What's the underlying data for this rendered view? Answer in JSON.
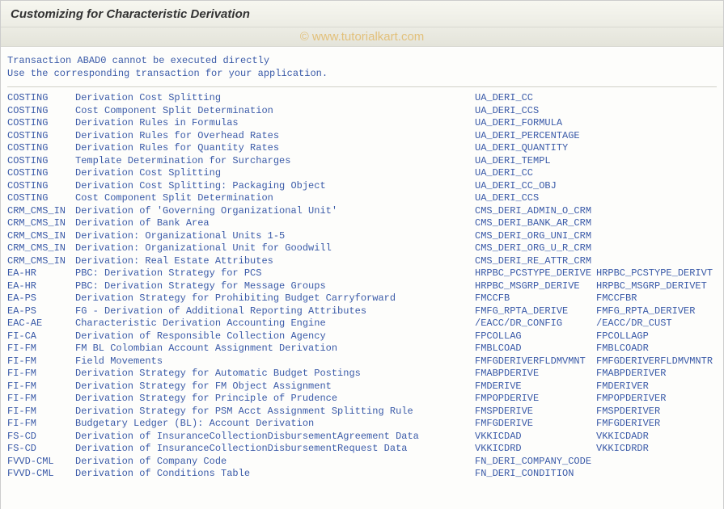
{
  "header": {
    "title": "Customizing for Characteristic Derivation",
    "watermark": "© www.tutorialkart.com"
  },
  "message": {
    "line1": "Transaction ABAD0 cannot be executed directly",
    "line2": "Use the corresponding transaction for your application."
  },
  "rows": [
    {
      "cat": "COSTING",
      "desc": "Derivation Cost Splitting",
      "cmd": "UA_DERI_CC",
      "cmd2": ""
    },
    {
      "cat": "COSTING",
      "desc": "Cost Component Split Determination",
      "cmd": "UA_DERI_CCS",
      "cmd2": ""
    },
    {
      "cat": "COSTING",
      "desc": "Derivation Rules in Formulas",
      "cmd": "UA_DERI_FORMULA",
      "cmd2": ""
    },
    {
      "cat": "COSTING",
      "desc": "Derivation Rules for Overhead Rates",
      "cmd": "UA_DERI_PERCENTAGE",
      "cmd2": ""
    },
    {
      "cat": "COSTING",
      "desc": "Derivation Rules for Quantity Rates",
      "cmd": "UA_DERI_QUANTITY",
      "cmd2": ""
    },
    {
      "cat": "COSTING",
      "desc": "Template Determination for Surcharges",
      "cmd": "UA_DERI_TEMPL",
      "cmd2": ""
    },
    {
      "cat": "COSTING",
      "desc": "Derivation Cost Splitting",
      "cmd": "UA_DERI_CC",
      "cmd2": ""
    },
    {
      "cat": "COSTING",
      "desc": "Derivation Cost Splitting: Packaging Object",
      "cmd": "UA_DERI_CC_OBJ",
      "cmd2": ""
    },
    {
      "cat": "COSTING",
      "desc": "Cost Component Split Determination",
      "cmd": "UA_DERI_CCS",
      "cmd2": ""
    },
    {
      "cat": "CRM_CMS_IN",
      "desc": "Derivation of 'Governing Organizational Unit'",
      "cmd": "CMS_DERI_ADMIN_O_CRM",
      "cmd2": ""
    },
    {
      "cat": "CRM_CMS_IN",
      "desc": "Derivation of Bank Area",
      "cmd": "CMS_DERI_BANK_AR_CRM",
      "cmd2": ""
    },
    {
      "cat": "CRM_CMS_IN",
      "desc": "Derivation: Organizational Units 1-5",
      "cmd": "CMS_DERI_ORG_UNI_CRM",
      "cmd2": ""
    },
    {
      "cat": "CRM_CMS_IN",
      "desc": "Derivation: Organizational Unit for Goodwill",
      "cmd": "CMS_DERI_ORG_U_R_CRM",
      "cmd2": ""
    },
    {
      "cat": "CRM_CMS_IN",
      "desc": "Derivation: Real Estate Attributes",
      "cmd": "CMS_DERI_RE_ATTR_CRM",
      "cmd2": ""
    },
    {
      "cat": "EA-HR",
      "desc": "PBC: Derivation Strategy for PCS",
      "cmd": "HRPBC_PCSTYPE_DERIVE",
      "cmd2": "HRPBC_PCSTYPE_DERIVT"
    },
    {
      "cat": "EA-HR",
      "desc": "PBC: Derivation Strategy for Message Groups",
      "cmd": "HRPBC_MSGRP_DERIVE",
      "cmd2": "HRPBC_MSGRP_DERIVET"
    },
    {
      "cat": "EA-PS",
      "desc": "Derivation Strategy for Prohibiting Budget Carryforward",
      "cmd": "FMCCFB",
      "cmd2": "FMCCFBR"
    },
    {
      "cat": "EA-PS",
      "desc": "FG - Derivation of Additional Reporting Attributes",
      "cmd": "FMFG_RPTA_DERIVE",
      "cmd2": "FMFG_RPTA_DERIVER"
    },
    {
      "cat": "EAC-AE",
      "desc": "Characteristic Derivation Accounting Engine",
      "cmd": "/EACC/DR_CONFIG",
      "cmd2": "/EACC/DR_CUST"
    },
    {
      "cat": "FI-CA",
      "desc": "Derivation of Responsible Collection Agency",
      "cmd": "FPCOLLAG",
      "cmd2": "FPCOLLAGP"
    },
    {
      "cat": "FI-FM",
      "desc": "FM BL Colombian Account Assignment Derivation",
      "cmd": "FMBLCOAD",
      "cmd2": "FMBLCOADR"
    },
    {
      "cat": "FI-FM",
      "desc": "Field Movements",
      "cmd": "FMFGDERIVERFLDMVMNT",
      "cmd2": "FMFGDERIVERFLDMVMNTR"
    },
    {
      "cat": "FI-FM",
      "desc": "Derivation Strategy for Automatic Budget Postings",
      "cmd": "FMABPDERIVE",
      "cmd2": "FMABPDERIVER"
    },
    {
      "cat": "FI-FM",
      "desc": "Derivation Strategy for FM Object Assignment",
      "cmd": "FMDERIVE",
      "cmd2": "FMDERIVER"
    },
    {
      "cat": "FI-FM",
      "desc": "Derivation Strategy for Principle of Prudence",
      "cmd": "FMPOPDERIVE",
      "cmd2": "FMPOPDERIVER"
    },
    {
      "cat": "FI-FM",
      "desc": "Derivation Strategy for PSM Acct Assignment Splitting Rule",
      "cmd": "FMSPDERIVE",
      "cmd2": "FMSPDERIVER"
    },
    {
      "cat": "FI-FM",
      "desc": "Budgetary Ledger (BL): Account Derivation",
      "cmd": "FMFGDERIVE",
      "cmd2": "FMFGDERIVER"
    },
    {
      "cat": "FS-CD",
      "desc": "Derivation of InsuranceCollectionDisbursementAgreement Data",
      "cmd": "VKKICDAD",
      "cmd2": "VKKICDADR"
    },
    {
      "cat": "FS-CD",
      "desc": "Derivation of InsuranceCollectionDisbursementRequest Data",
      "cmd": "VKKICDRD",
      "cmd2": "VKKICDRDR"
    },
    {
      "cat": "FVVD-CML",
      "desc": "Derivation of Company Code",
      "cmd": "FN_DERI_COMPANY_CODE",
      "cmd2": ""
    },
    {
      "cat": "FVVD-CML",
      "desc": "Derivation of Conditions Table",
      "cmd": "FN_DERI_CONDITION",
      "cmd2": ""
    }
  ]
}
